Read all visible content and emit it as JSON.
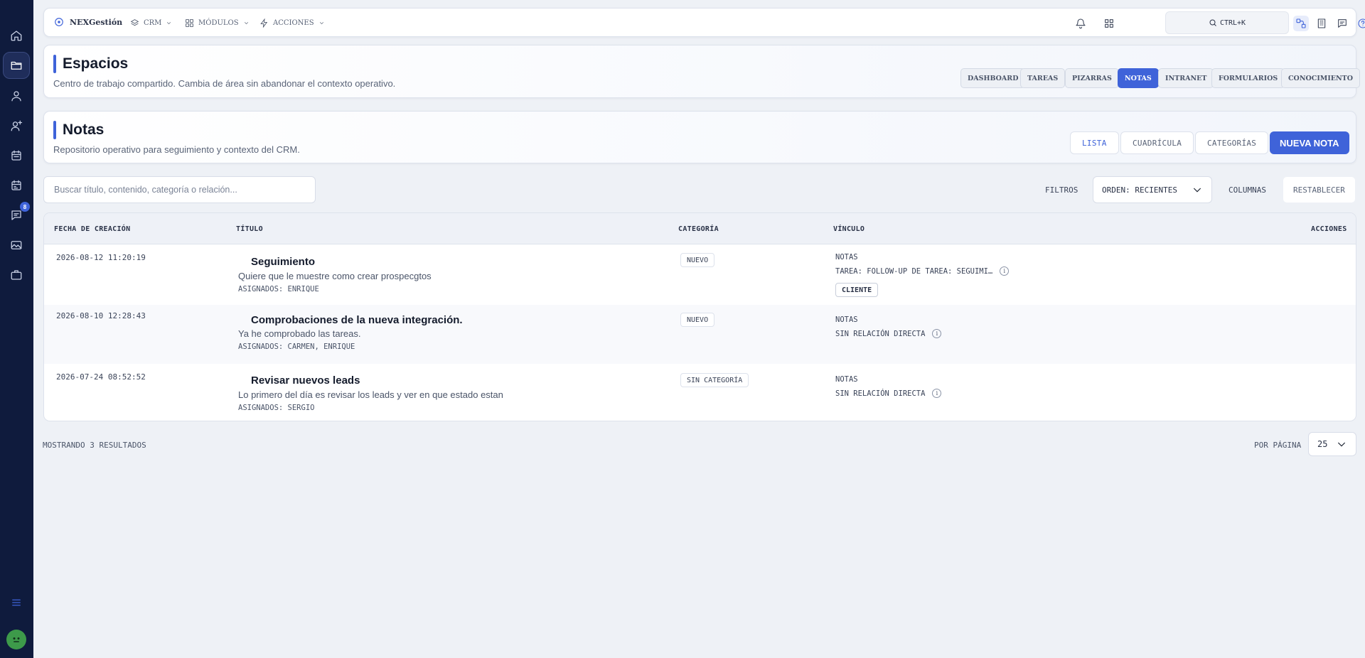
{
  "sidebar": {
    "badge_count": "8",
    "items": [
      "home-icon",
      "folder-icon",
      "user-icon",
      "user-plus-icon",
      "calendar-icon",
      "calendar-alt-icon",
      "chat-icon",
      "image-icon",
      "briefcase-icon"
    ]
  },
  "topbar": {
    "brand": "NEXGestión",
    "nav": [
      {
        "label": "CRM"
      },
      {
        "label": "MÓDULOS"
      },
      {
        "label": "ACCIONES"
      }
    ],
    "search_shortcut": "CTRL+K"
  },
  "workspace": {
    "title": "Espacios",
    "subtitle": "Centro de trabajo compartido. Cambia de área sin abandonar el contexto operativo.",
    "tabs": [
      {
        "label": "DASHBOARD",
        "active": false
      },
      {
        "label": "TAREAS",
        "active": false
      },
      {
        "label": "PIZARRAS",
        "active": false
      },
      {
        "label": "NOTAS",
        "active": true
      },
      {
        "label": "INTRANET",
        "active": false
      },
      {
        "label": "FORMULARIOS",
        "active": false
      },
      {
        "label": "CONOCIMIENTO",
        "active": false
      }
    ]
  },
  "notes": {
    "title": "Notas",
    "subtitle": "Repositorio operativo para seguimiento y contexto del CRM.",
    "views": [
      "LISTA",
      "CUADRÍCULA",
      "CATEGORÍAS"
    ],
    "new_button": "NUEVA NOTA"
  },
  "filters": {
    "search_placeholder": "Buscar título, contenido, categoría o relación...",
    "filters_label": "FILTROS",
    "order_label": "ORDEN: RECIENTES",
    "columns_label": "COLUMNAS",
    "reset_label": "RESTABLECER"
  },
  "table": {
    "headers": {
      "date": "FECHA DE CREACIÓN",
      "title": "TÍTULO",
      "category": "CATEGORÍA",
      "link": "VÍNCULO",
      "actions": "ACCIONES"
    },
    "rows": [
      {
        "date": "2026-08-12 11:20:19",
        "title": "Seguimiento",
        "content": "Quiere que le muestre como crear prospecgtos",
        "assigned": "ASIGNADOS: ENRIQUE",
        "category": "NUEVO",
        "link_type": "NOTAS",
        "link_detail": "TAREA: FOLLOW-UP DE TAREA: SEGUIMI…",
        "link_badge": "CLIENTE"
      },
      {
        "date": "2026-08-10 12:28:43",
        "title": "Comprobaciones de la nueva integración.",
        "content": "Ya he comprobado las tareas.",
        "assigned": "ASIGNADOS: CARMEN, ENRIQUE",
        "category": "NUEVO",
        "link_type": "NOTAS",
        "link_detail": "SIN RELACIÓN DIRECTA"
      },
      {
        "date": "2026-07-24 08:52:52",
        "title": "Revisar nuevos leads",
        "content": "Lo primero del día es revisar los leads y ver en que estado estan",
        "assigned": "ASIGNADOS: SERGIO",
        "category": "SIN CATEGORÍA",
        "link_type": "NOTAS",
        "link_detail": "SIN RELACIÓN DIRECTA"
      }
    ]
  },
  "footer": {
    "results": "MOSTRANDO 3 RESULTADOS",
    "per_page_label": "POR PÁGINA",
    "per_page_value": "25"
  },
  "colors": {
    "accent": "#3f63d9",
    "sidebar": "#0f1b3d",
    "background": "#eef1f6"
  }
}
